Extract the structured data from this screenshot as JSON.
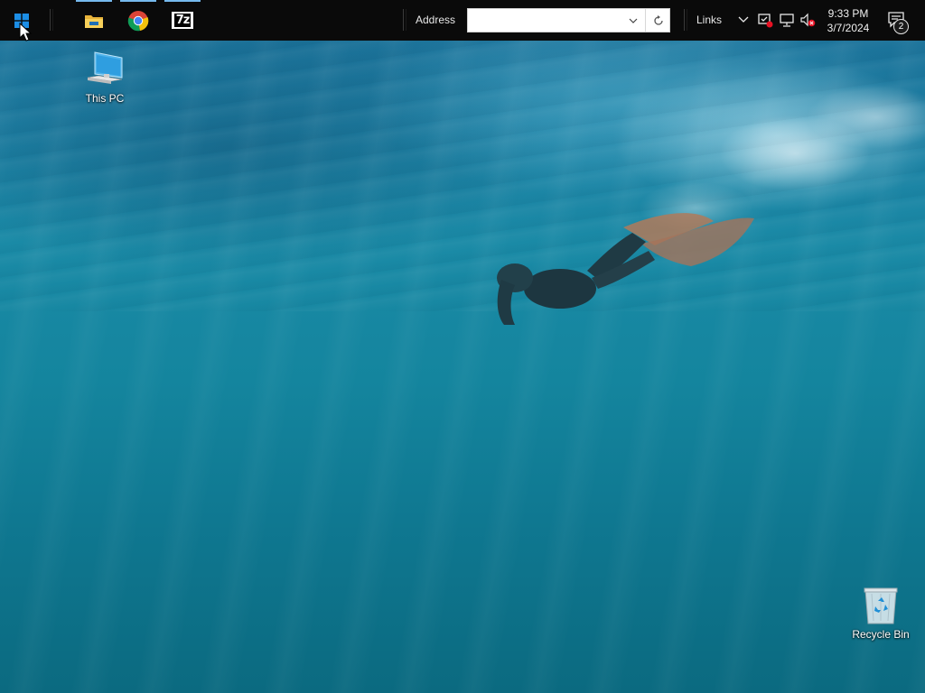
{
  "taskbar": {
    "pinned": [
      {
        "name": "File Explorer",
        "icon": "folder-icon"
      },
      {
        "name": "Google Chrome",
        "icon": "chrome-icon"
      },
      {
        "name": "7-Zip",
        "icon": "7zip-icon",
        "text": "7z"
      }
    ],
    "address_label": "Address",
    "address_value": "",
    "links_label": "Links",
    "clock": {
      "time": "9:33 PM",
      "date": "3/7/2024"
    },
    "notification_count": "2",
    "accent": "#76b9ed"
  },
  "desktop": {
    "icons": [
      {
        "label": "This PC",
        "icon": "computer-icon"
      },
      {
        "label": "Recycle Bin",
        "icon": "recycle-bin-icon"
      }
    ]
  }
}
